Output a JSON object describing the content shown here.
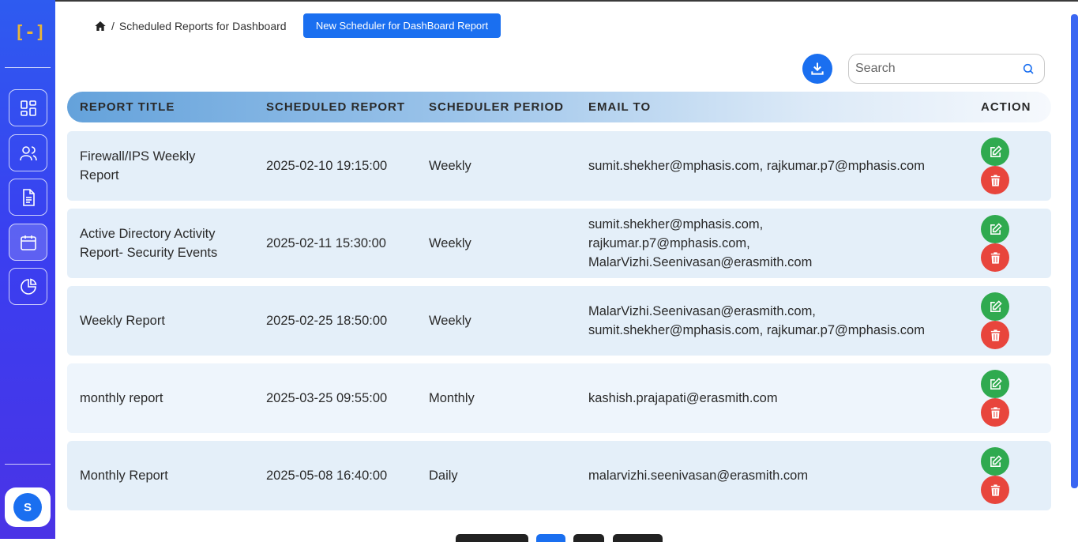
{
  "app": {
    "logo_text": "[-]",
    "avatar_initial": "S",
    "accent_color": "#1a6ff0"
  },
  "sidebar": {
    "items": [
      {
        "name": "dashboard",
        "icon": "dashboard-grid-icon"
      },
      {
        "name": "users",
        "icon": "users-icon"
      },
      {
        "name": "reports",
        "icon": "document-icon"
      },
      {
        "name": "scheduler",
        "icon": "calendar-icon",
        "active": true
      },
      {
        "name": "analytics",
        "icon": "pie-chart-icon"
      }
    ]
  },
  "header": {
    "breadcrumb_separator": "/",
    "breadcrumb_page": "Scheduled Reports for Dashboard",
    "new_button_label": "New Scheduler for DashBoard Report"
  },
  "toolbar": {
    "search_placeholder": "Search",
    "download_icon": "download-icon",
    "search_icon": "search-icon"
  },
  "table": {
    "columns": [
      "REPORT TITLE",
      "SCHEDULED REPORT",
      "SCHEDULER PERIOD",
      "EMAIL TO",
      "ACTION"
    ],
    "rows": [
      {
        "title_lines": [
          "Firewall/IPS Weekly",
          "Report"
        ],
        "scheduled": "2025-02-10 19:15:00",
        "period": "Weekly",
        "email_lines": [
          "sumit.shekher@mphasis.com, rajkumar.p7@mphasis.com"
        ]
      },
      {
        "title_lines": [
          "Active Directory Activity",
          "Report- Security Events"
        ],
        "scheduled": "2025-02-11 15:30:00",
        "period": "Weekly",
        "email_lines": [
          "sumit.shekher@mphasis.com,",
          "rajkumar.p7@mphasis.com,",
          "MalarVizhi.Seenivasan@erasmith.com"
        ]
      },
      {
        "title_lines": [
          "Weekly Report"
        ],
        "scheduled": "2025-02-25 18:50:00",
        "period": "Weekly",
        "email_lines": [
          "MalarVizhi.Seenivasan@erasmith.com,",
          "sumit.shekher@mphasis.com, rajkumar.p7@mphasis.com"
        ]
      },
      {
        "title_lines": [
          "monthly report"
        ],
        "scheduled": "2025-03-25 09:55:00",
        "period": "Monthly",
        "email_lines": [
          "kashish.prajapati@erasmith.com"
        ]
      },
      {
        "title_lines": [
          "Monthly Report"
        ],
        "scheduled": "2025-05-08 16:40:00",
        "period": "Daily",
        "email_lines": [
          "malarvizhi.seenivasan@erasmith.com"
        ]
      }
    ]
  }
}
